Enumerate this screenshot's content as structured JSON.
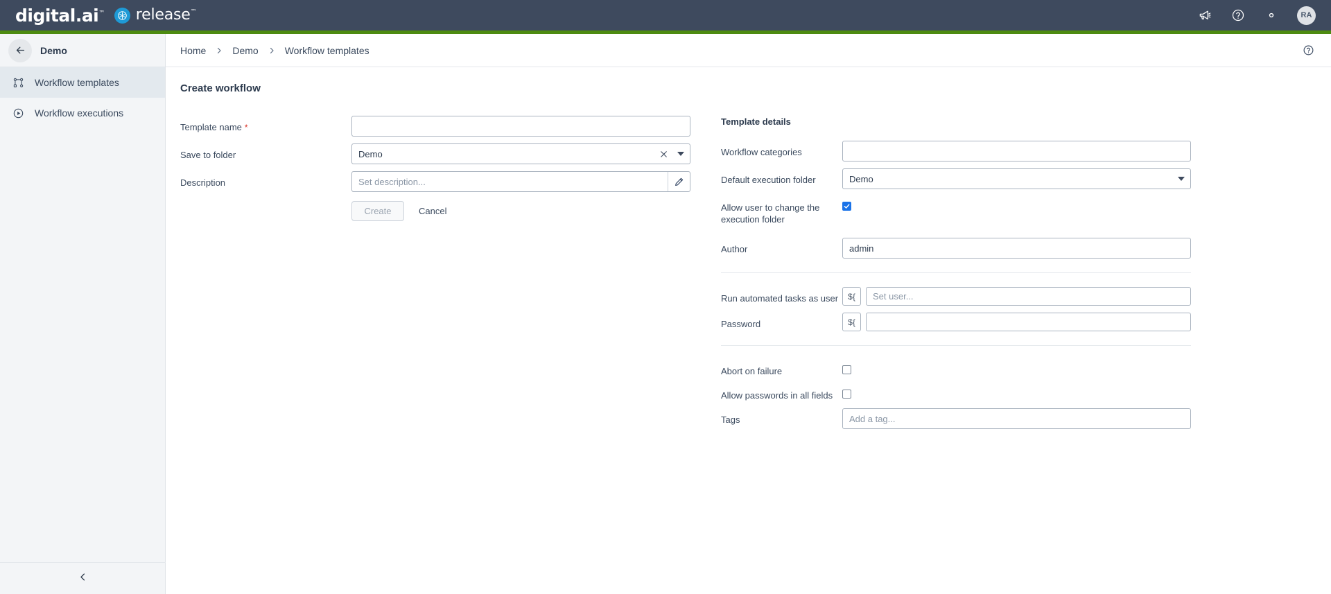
{
  "colors": {
    "header_bg": "#3e4a5e",
    "accent_green": "#4d8b10",
    "brand_blue": "#1e9ad6",
    "checkbox_checked": "#1a73e8",
    "required_red": "#d93025"
  },
  "topbar": {
    "brand_primary": "digital.ai",
    "brand_trademark": "™",
    "brand_product": "release",
    "icons": [
      {
        "name": "announcements-icon",
        "label": "Announcements"
      },
      {
        "name": "help-icon",
        "label": "Help"
      },
      {
        "name": "settings-gear-icon",
        "label": "Settings"
      }
    ],
    "avatar_initials": "RA"
  },
  "sidebar": {
    "back_label": "Back",
    "title": "Demo",
    "items": [
      {
        "label": "Workflow templates",
        "icon": "workflow-nodes-icon",
        "active": true
      },
      {
        "label": "Workflow executions",
        "icon": "play-circle-icon",
        "active": false
      }
    ],
    "collapse_label": "Collapse"
  },
  "breadcrumb": {
    "items": [
      "Home",
      "Demo",
      "Workflow templates"
    ],
    "separator": "›",
    "help_label": "Help"
  },
  "main": {
    "page_title": "Create workflow",
    "form": {
      "template_name": {
        "label": "Template name",
        "required_marker": "*",
        "value": "",
        "placeholder": ""
      },
      "save_to_folder": {
        "label": "Save to folder",
        "value": "Demo",
        "clear_label": "✕",
        "options": [
          "Demo"
        ]
      },
      "description": {
        "label": "Description",
        "value": "",
        "placeholder": "Set description..."
      },
      "create_label": "Create",
      "cancel_label": "Cancel"
    }
  },
  "details": {
    "panel_title": "Template details",
    "workflow_categories": {
      "label": "Workflow categories",
      "value": "",
      "placeholder": ""
    },
    "default_execution_folder": {
      "label": "Default execution folder",
      "value": "Demo",
      "options": [
        "Demo"
      ]
    },
    "allow_change_folder": {
      "label": "Allow user to change the execution folder",
      "checked": true,
      "check_glyph": "✓"
    },
    "author": {
      "label": "Author",
      "value": "admin",
      "placeholder": ""
    },
    "run_as_user": {
      "label": "Run automated tasks as user",
      "var_prefix": "${",
      "value": "",
      "placeholder": "Set user..."
    },
    "password": {
      "label": "Password",
      "var_prefix": "${",
      "value": "",
      "placeholder": ""
    },
    "abort_on_failure": {
      "label": "Abort on failure",
      "checked": false
    },
    "allow_passwords_all_fields": {
      "label": "Allow passwords in all fields",
      "checked": false
    },
    "tags": {
      "label": "Tags",
      "value": "",
      "placeholder": "Add a tag..."
    }
  }
}
